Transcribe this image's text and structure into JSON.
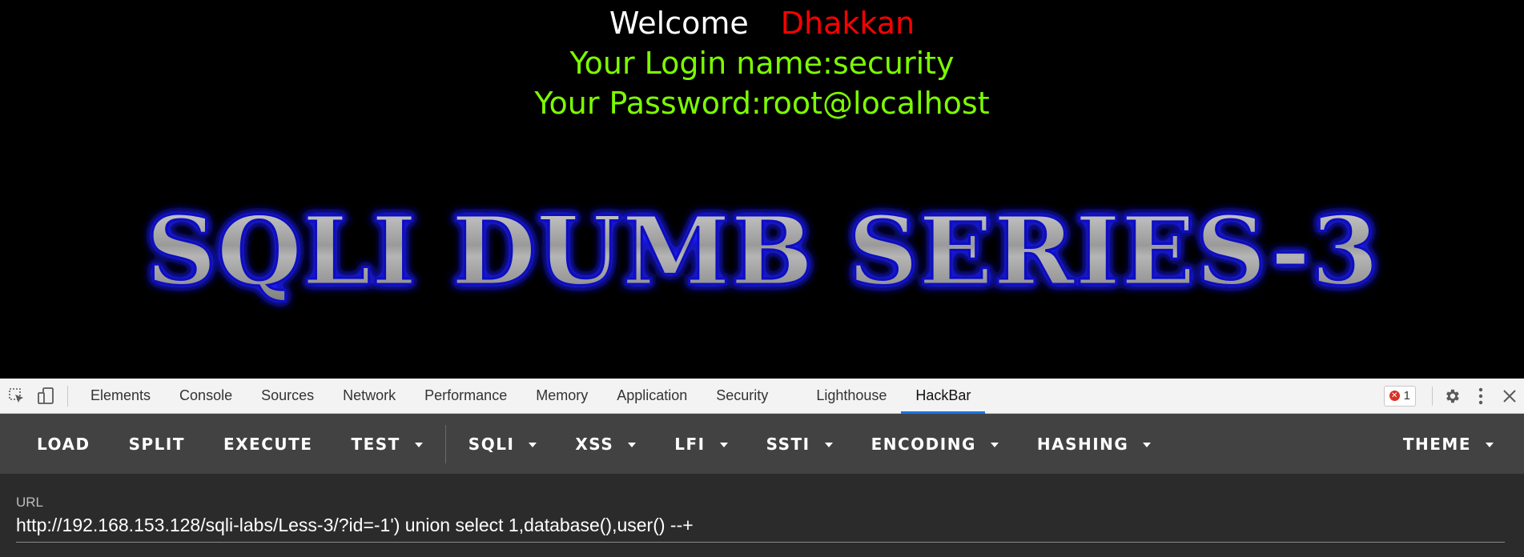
{
  "page": {
    "welcome_label": "Welcome",
    "welcome_name": "Dhakkan",
    "login_line": "Your Login name:security",
    "password_line": "Your Password:root@localhost",
    "banner_text": "SQLI DUMB SERIES-3"
  },
  "devtools": {
    "tabs": [
      "Elements",
      "Console",
      "Sources",
      "Network",
      "Performance",
      "Memory",
      "Application",
      "Security",
      "Lighthouse",
      "HackBar"
    ],
    "active_tab": "HackBar",
    "error_count": "1"
  },
  "hackbar": {
    "buttons": [
      {
        "label": "LOAD",
        "dropdown": false
      },
      {
        "label": "SPLIT",
        "dropdown": false
      },
      {
        "label": "EXECUTE",
        "dropdown": false
      },
      {
        "label": "TEST",
        "dropdown": true
      },
      {
        "label": "SQLI",
        "dropdown": true
      },
      {
        "label": "XSS",
        "dropdown": true
      },
      {
        "label": "LFI",
        "dropdown": true
      },
      {
        "label": "SSTI",
        "dropdown": true
      },
      {
        "label": "ENCODING",
        "dropdown": true
      },
      {
        "label": "HASHING",
        "dropdown": true
      }
    ],
    "theme_label": "THEME",
    "url_label": "URL",
    "url_value": "http://192.168.153.128/sqli-labs/Less-3/?id=-1') union select 1,database(),user() --+"
  },
  "colors": {
    "welcome": "#ffffff",
    "name": "#ff0000",
    "info": "#7cfc00",
    "banner_glow": "#1a1aff",
    "hackbar_bg": "#424242",
    "active_tab_underline": "#1a73e8"
  },
  "icons": {
    "inspect": "inspect-element-icon",
    "device": "device-toolbar-icon",
    "settings": "gear-icon",
    "more": "more-vertical-icon",
    "close": "close-icon"
  }
}
